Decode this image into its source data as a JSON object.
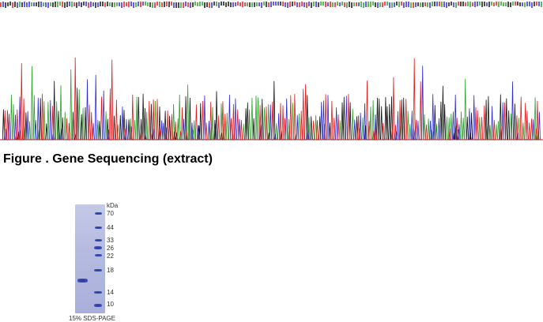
{
  "figure_caption": "Figure . Gene Sequencing (extract)",
  "gel": {
    "unit_label": "kDa",
    "markers": [
      "70",
      "44",
      "33",
      "26",
      "22",
      "18",
      "14",
      "10"
    ],
    "caption": "15% SDS-PAGE"
  },
  "colors": {
    "trace_A": "#2ca02c",
    "trace_C": "#2b2bd6",
    "trace_G": "#111111",
    "trace_T": "#e31a1c",
    "gel_background": "#b6bbe0",
    "gel_band": "#2b3aa3"
  }
}
